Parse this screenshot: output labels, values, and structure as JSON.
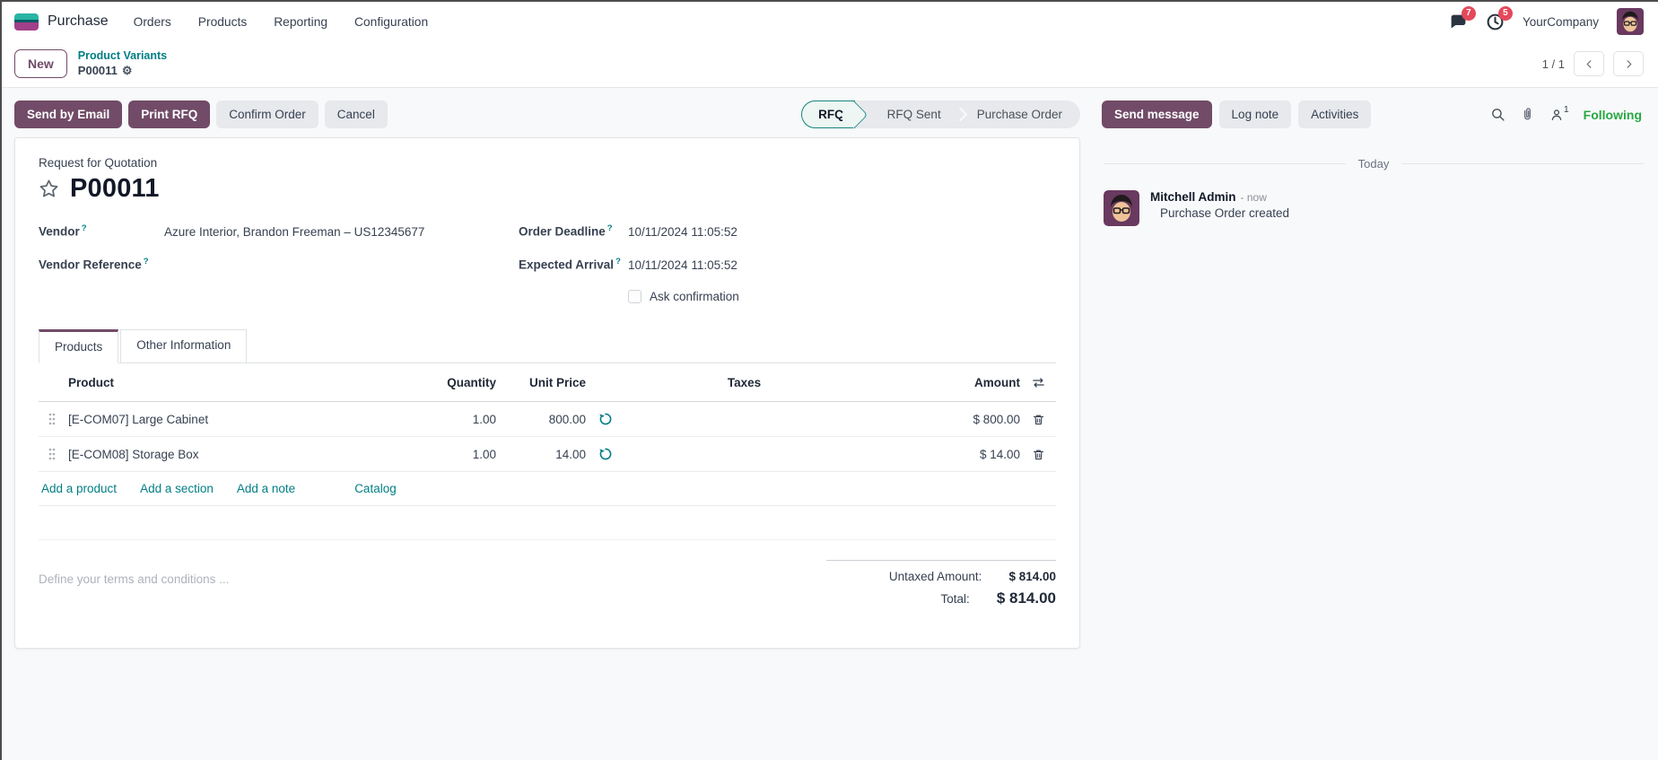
{
  "nav": {
    "app_name": "Purchase",
    "menu_items": [
      "Orders",
      "Products",
      "Reporting",
      "Configuration"
    ],
    "messages_badge": "7",
    "activities_badge": "5",
    "company": "YourCompany"
  },
  "breadcrumb": {
    "new_button": "New",
    "parent": "Product Variants",
    "current": "P00011",
    "pager": "1 / 1"
  },
  "actions": {
    "send_by_email": "Send by Email",
    "print_rfq": "Print RFQ",
    "confirm_order": "Confirm Order",
    "cancel": "Cancel"
  },
  "statusbar": {
    "steps": [
      {
        "label": "RFQ",
        "active": true
      },
      {
        "label": "RFQ Sent",
        "active": false
      },
      {
        "label": "Purchase Order",
        "active": false
      }
    ]
  },
  "chatter_bar": {
    "send_message": "Send message",
    "log_note": "Log note",
    "activities": "Activities",
    "followers_count": "1",
    "following": "Following"
  },
  "form": {
    "doc_type": "Request for Quotation",
    "name": "P00011",
    "fields": {
      "vendor_label": "Vendor",
      "vendor_value": "Azure Interior, Brandon Freeman – US12345677",
      "vendor_ref_label": "Vendor Reference",
      "order_deadline_label": "Order Deadline",
      "order_deadline_value": "10/11/2024 11:05:52",
      "expected_arrival_label": "Expected Arrival",
      "expected_arrival_value": "10/11/2024 11:05:52",
      "ask_confirmation_label": "Ask confirmation"
    },
    "tabs": [
      {
        "label": "Products",
        "active": true
      },
      {
        "label": "Other Information",
        "active": false
      }
    ],
    "table": {
      "headers": {
        "product": "Product",
        "quantity": "Quantity",
        "unit_price": "Unit Price",
        "taxes": "Taxes",
        "amount": "Amount"
      },
      "rows": [
        {
          "product": "[E-COM07] Large Cabinet",
          "quantity": "1.00",
          "unit_price": "800.00",
          "taxes": "",
          "amount": "$ 800.00"
        },
        {
          "product": "[E-COM08] Storage Box",
          "quantity": "1.00",
          "unit_price": "14.00",
          "taxes": "",
          "amount": "$ 14.00"
        }
      ],
      "links": [
        "Add a product",
        "Add a section",
        "Add a note",
        "Catalog"
      ]
    },
    "terms_placeholder": "Define your terms and conditions ...",
    "totals": {
      "untaxed_label": "Untaxed Amount:",
      "untaxed_value": "$ 814.00",
      "total_label": "Total:",
      "total_value": "$ 814.00"
    }
  },
  "chatter": {
    "date_divider": "Today",
    "messages": [
      {
        "author": "Mitchell Admin",
        "time": "- now",
        "body": "Purchase Order created"
      }
    ]
  },
  "colors": {
    "primary": "#714B67",
    "link_teal": "#017E84",
    "following_green": "#28a745",
    "badge_red": "#e4485b"
  }
}
